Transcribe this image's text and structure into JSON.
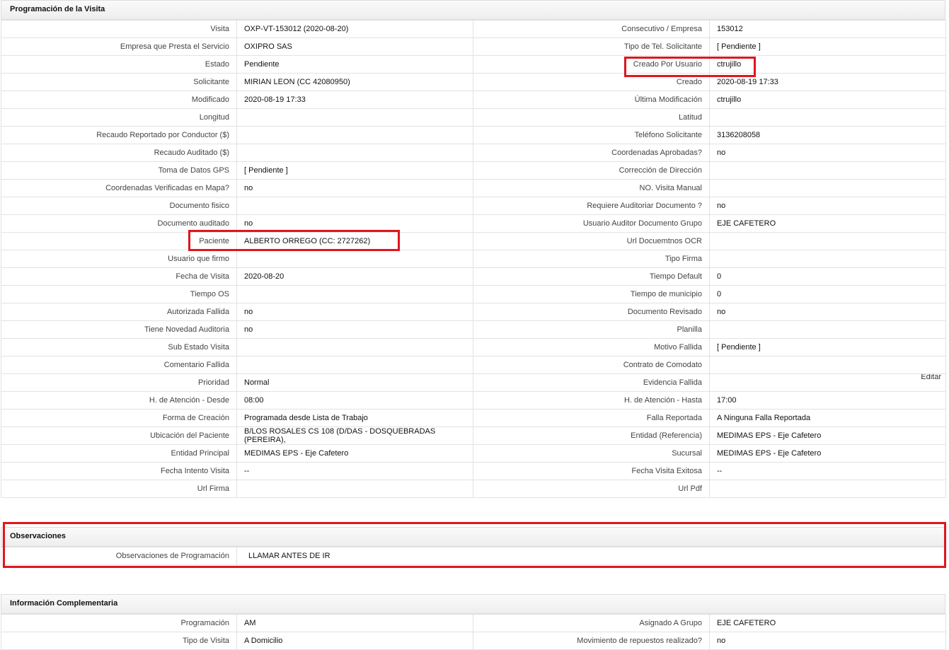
{
  "programacion": {
    "title": "Programación de la Visita",
    "rows": [
      {
        "l1": "Visita",
        "v1": "OXP-VT-153012 (2020-08-20)",
        "l2": "Consecutivo / Empresa",
        "v2": "153012"
      },
      {
        "l1": "Empresa que Presta el Servicio",
        "v1": "OXIPRO SAS",
        "l2": "Tipo de Tel. Solicitante",
        "v2": "[ Pendiente ]"
      },
      {
        "l1": "Estado",
        "v1": "Pendiente",
        "l2": "Creado Por Usuario",
        "v2": "ctrujillo"
      },
      {
        "l1": "Solicitante",
        "v1": "MIRIAN LEON (CC 42080950)",
        "l2": "Creado",
        "v2": "2020-08-19 17:33"
      },
      {
        "l1": "Modificado",
        "v1": "2020-08-19 17:33",
        "l2": "Última Modificación",
        "v2": " ctrujillo"
      },
      {
        "l1": "Longitud",
        "v1": "",
        "l2": "Latitud",
        "v2": ""
      },
      {
        "l1": "Recaudo Reportado por Conductor ($)",
        "v1": "",
        "l2": "Teléfono Solicitante",
        "v2": "3136208058"
      },
      {
        "l1": "Recaudo Auditado ($)",
        "v1": "",
        "l2": "Coordenadas Aprobadas?",
        "v2": " no"
      },
      {
        "l1": "Toma de Datos GPS",
        "v1": "[ Pendiente ]",
        "l2": "Corrección de Dirección",
        "v2": ""
      },
      {
        "l1": "Coordenadas Verificadas en Mapa?",
        "v1": " no",
        "l2": "NO. Visita Manual",
        "v2": ""
      },
      {
        "l1": "Documento fisico",
        "v1": "",
        "l2": "Requiere Auditoriar Documento ?",
        "v2": " no"
      },
      {
        "l1": "Documento auditado",
        "v1": " no",
        "l2": "Usuario Auditor Documento Grupo",
        "v2": "EJE CAFETERO"
      },
      {
        "l1": "Paciente",
        "v1": "ALBERTO ORREGO (CC: 2727262)",
        "l2": "Url Docuemtnos OCR",
        "v2": ""
      },
      {
        "l1": "Usuario que firmo",
        "v1": "",
        "l2": "Tipo Firma",
        "v2": ""
      },
      {
        "l1": "Fecha de Visita",
        "v1": " 2020-08-20",
        "l2": "Tiempo Default",
        "v2": "0"
      },
      {
        "l1": "Tiempo OS",
        "v1": "",
        "l2": "Tiempo de municipio",
        "v2": "0"
      },
      {
        "l1": "Autorizada Fallida",
        "v1": " no",
        "l2": "Documento Revisado",
        "v2": " no"
      },
      {
        "l1": "Tiene Novedad Auditoria",
        "v1": " no",
        "l2": "Planilla",
        "v2": ""
      },
      {
        "l1": "Sub Estado Visita",
        "v1": "",
        "l2": "Motivo Fallida",
        "v2": "[ Pendiente ]"
      },
      {
        "l1": "Comentario Fallida",
        "v1": "",
        "l2": "Contrato de Comodato",
        "v2": ""
      },
      {
        "l1": "Prioridad",
        "v1": "Normal",
        "l2": "Evidencia Fallida",
        "v2": ""
      },
      {
        "l1": "H. de Atención - Desde",
        "v1": "08:00",
        "l2": "H. de Atención - Hasta",
        "v2": "17:00"
      },
      {
        "l1": "Forma de Creación",
        "v1": "Programada desde Lista de Trabajo",
        "l2": "Falla Reportada",
        "v2": "A Ninguna Falla Reportada"
      },
      {
        "l1": "Ubicación del Paciente",
        "v1": "B/LOS ROSALES CS 108 (D/DAS - DOSQUEBRADAS (PEREIRA),",
        "l2": "Entidad (Referencia)",
        "v2": "MEDIMAS EPS - Eje Cafetero"
      },
      {
        "l1": "Entidad Principal",
        "v1": "MEDIMAS EPS - Eje Cafetero",
        "l2": "Sucursal",
        "v2": "MEDIMAS EPS - Eje Cafetero"
      },
      {
        "l1": "Fecha Intento Visita",
        "v1": " --",
        "l2": "Fecha Visita Exitosa",
        "v2": " --"
      },
      {
        "l1": "Url Firma",
        "v1": "",
        "l2": "Url Pdf",
        "v2": ""
      }
    ],
    "edit_link": "Editar"
  },
  "observaciones": {
    "title": "Observaciones",
    "label": "Observaciones de Programación",
    "value": "LLAMAR ANTES DE IR"
  },
  "complementaria": {
    "title": "Información Complementaria",
    "rows": [
      {
        "l1": "Programación",
        "v1": "AM",
        "l2": "Asignado A Grupo",
        "v2": "EJE CAFETERO"
      },
      {
        "l1": "Tipo de Visita",
        "v1": "A Domicilio",
        "l2": "Movimiento de repuestos realizado?",
        "v2": " no"
      }
    ]
  },
  "colors": {
    "highlight": "#e0151f",
    "border": "#e2e2e2"
  }
}
